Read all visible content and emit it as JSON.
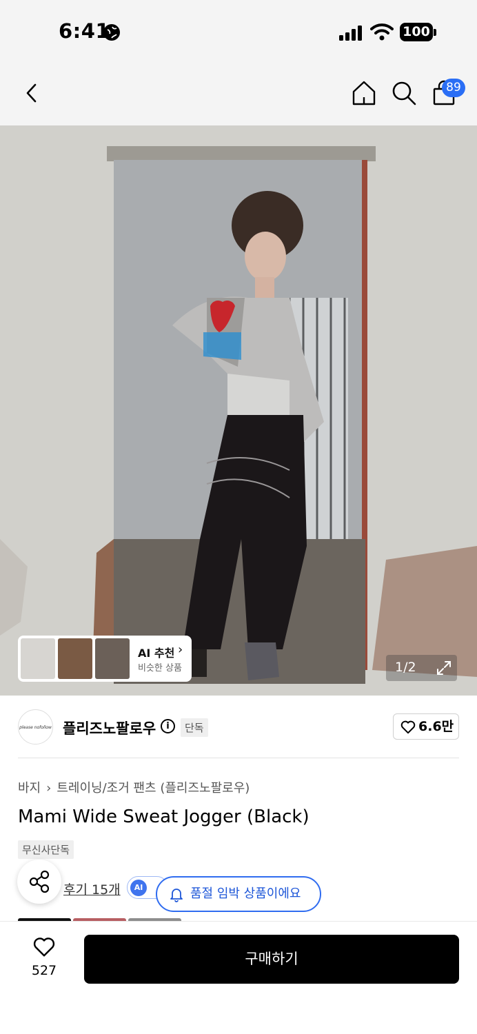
{
  "status_bar": {
    "time": "6:41",
    "battery": "100"
  },
  "header": {
    "cart_count": "89"
  },
  "gallery": {
    "counter": "1/2"
  },
  "ai_recommend": {
    "title": "AI 추천",
    "subtitle": "비슷한 상품"
  },
  "brand": {
    "name": "플리즈노팔로우",
    "logo_text": "please nofollow",
    "badge": "단독",
    "likes": "6.6만"
  },
  "breadcrumb": {
    "category": "바지",
    "subcategory": "트레이닝/조거 팬츠 (플리즈노팔로우)"
  },
  "product": {
    "title": "Mami Wide Sweat Jogger (Black)",
    "tag": "무신사단독",
    "reviews": "후기 15개",
    "ai_label": "AI"
  },
  "toast": {
    "message": "품절 임박 상품이에요"
  },
  "bottom_bar": {
    "wishlist_count": "527",
    "buy_label": "구매하기"
  },
  "colors": {
    "accent": "#2f6cf0",
    "badge_blue": "#2a6ef5",
    "buy_button": "#000000"
  }
}
